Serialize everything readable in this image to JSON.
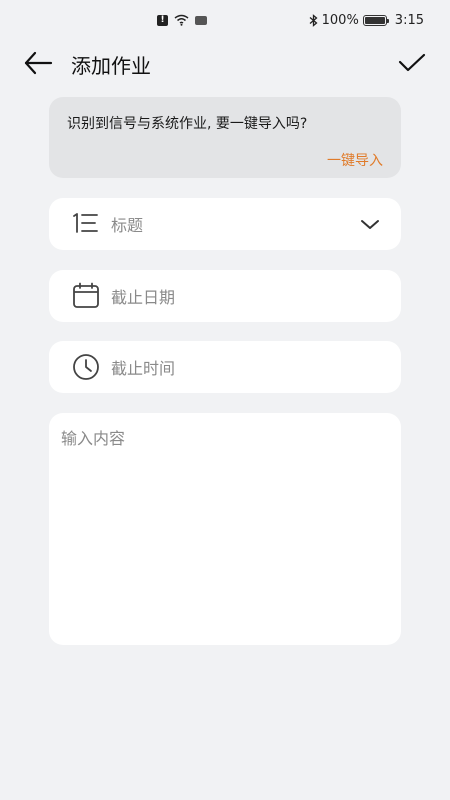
{
  "status_bar": {
    "battery": "100%",
    "time": "3:15"
  },
  "header": {
    "title": "添加作业"
  },
  "import_banner": {
    "message": "识别到信号与系统作业, 要一键导入吗?",
    "action_label": "一键导入",
    "action_color": "#e07b2a"
  },
  "form": {
    "title_placeholder": "标题",
    "deadline_date_placeholder": "截止日期",
    "deadline_time_placeholder": "截止时间",
    "content_placeholder": "输入内容"
  },
  "icons": {
    "back": "arrow-left-icon",
    "confirm": "check-icon",
    "title": "list-numbered-icon",
    "date": "calendar-icon",
    "time": "clock-icon",
    "expand": "chevron-down-icon"
  },
  "colors": {
    "background": "#f1f2f4",
    "card": "#ffffff",
    "banner": "#e3e4e6",
    "accent": "#e07b2a"
  }
}
